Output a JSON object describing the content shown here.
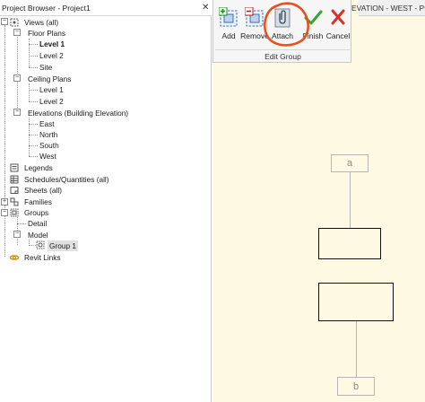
{
  "project_browser": {
    "title": "Project Browser - Project1",
    "close_glyph": "✕",
    "tree": {
      "views": "Views (all)",
      "floor_plans": "Floor Plans",
      "level1": "Level 1",
      "level2": "Level 2",
      "site": "Site",
      "ceiling_plans": "Ceiling Plans",
      "c_level1": "Level 1",
      "c_level2": "Level 2",
      "elevations": "Elevations (Building Elevation)",
      "east": "East",
      "north": "North",
      "south": "South",
      "west": "West",
      "legends": "Legends",
      "schedules": "Schedules/Quantities (all)",
      "sheets": "Sheets (all)",
      "families": "Families",
      "groups": "Groups",
      "detail": "Detail",
      "model": "Model",
      "group1": "Group 1",
      "revit_links": "Revit Links"
    }
  },
  "view_tab": {
    "title": "EVATION - WEST - PR..."
  },
  "edit_group": {
    "panel_label": "Edit Group",
    "tools": {
      "add": "Add",
      "remove": "Remove",
      "attach": "Attach",
      "finish": "Finish",
      "cancel": "Cancel"
    }
  },
  "canvas": {
    "tag_a": "a",
    "tag_b": "b"
  },
  "colors": {
    "canvas_bg": "#fdf9e3",
    "finish_green": "#3aa335",
    "cancel_red": "#d8322b",
    "highlight_circle": "#e8501e"
  }
}
